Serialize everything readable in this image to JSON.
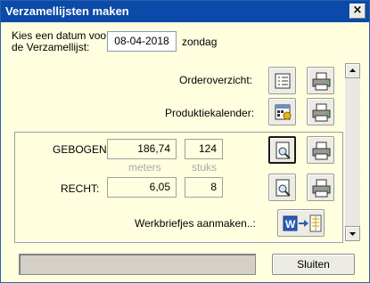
{
  "window": {
    "title": "Verzamellijsten maken",
    "close_glyph": "×"
  },
  "date_prompt": {
    "line1": "Kies een datum voor",
    "line2": "de Verzamellijst:",
    "value": "08-04-2018",
    "weekday": "zondag"
  },
  "orderoverzicht": {
    "label": "Orderoverzicht:"
  },
  "produktiekalender": {
    "label": "Produktiekalender:"
  },
  "gebogen": {
    "label": "GEBOGEN:",
    "meters": "186,74",
    "stuks": "124"
  },
  "recht": {
    "label": "RECHT:",
    "meters": "6,05",
    "stuks": "8"
  },
  "units": {
    "meters": "meters",
    "stuks": "stuks"
  },
  "werkbriefjes": {
    "label": "Werkbriefjes aanmaken..:"
  },
  "footer": {
    "status_text": "",
    "close_label": "Sluiten"
  },
  "icons": {
    "list": "list-icon",
    "printer": "printer-icon",
    "calendar": "calendar-icon",
    "preview": "print-preview-icon",
    "word_export": "word-export-icon"
  },
  "colors": {
    "titlebar": "#0b4aa8",
    "window_bg": "#ffffe0",
    "button_face": "#ecebe4"
  }
}
